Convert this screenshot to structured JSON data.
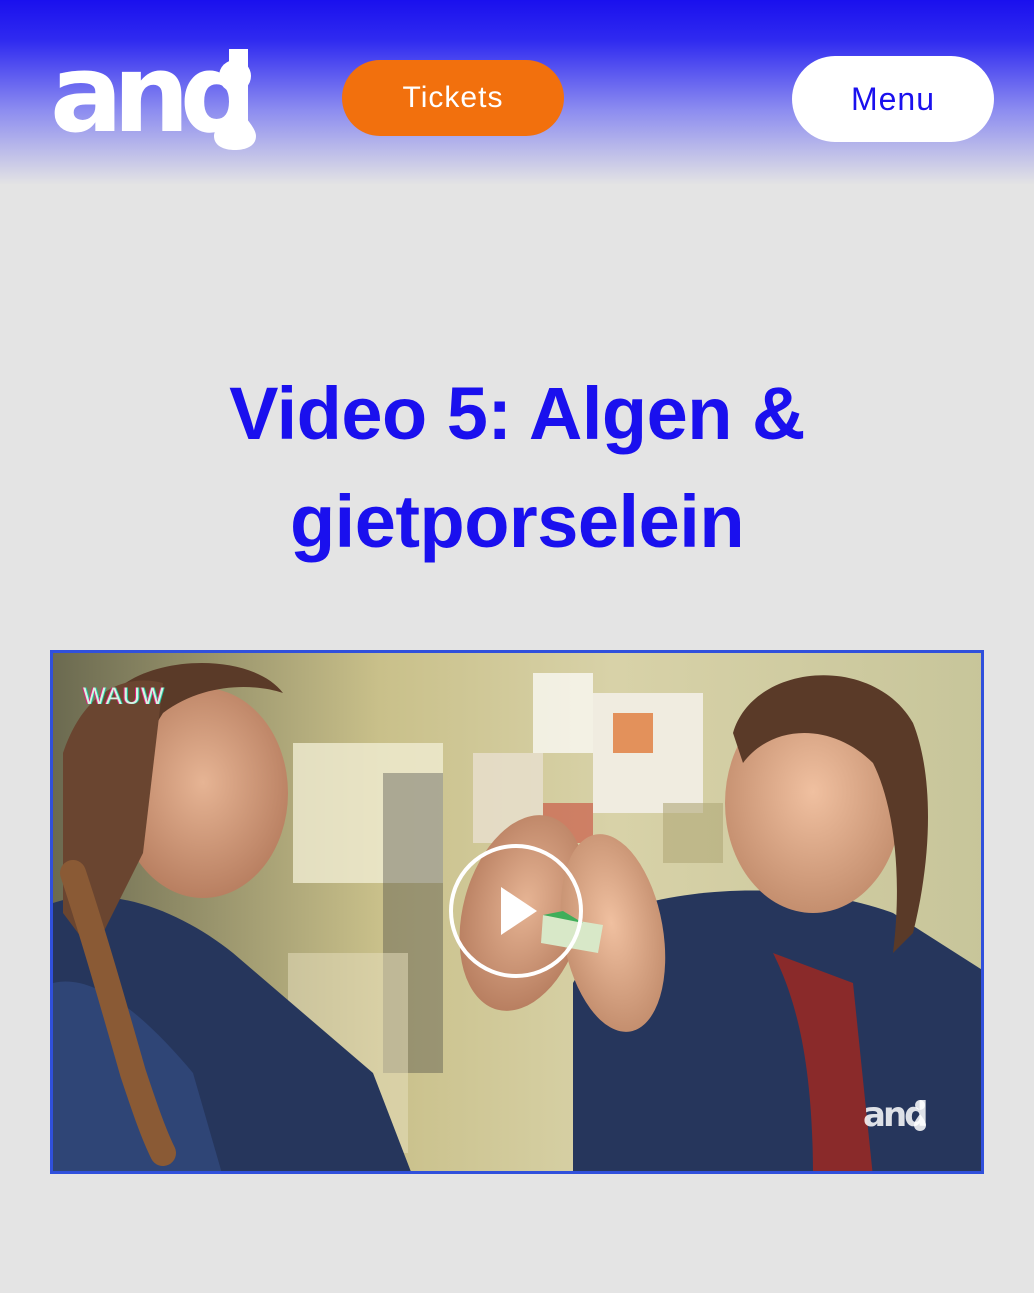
{
  "header": {
    "logo": {
      "text": "and",
      "name": "and logo"
    },
    "tickets_label": "Tickets",
    "menu_label": "Menu"
  },
  "main": {
    "title": "Video 5: Algen & gietporselein",
    "video": {
      "corner_label": "WAUW",
      "watermark": "and",
      "play_icon": "play-icon"
    }
  },
  "colors": {
    "brand_blue": "#1a10ee",
    "tickets_orange": "#f2700d",
    "background": "#e4e4e4",
    "video_border": "#3050dc"
  }
}
